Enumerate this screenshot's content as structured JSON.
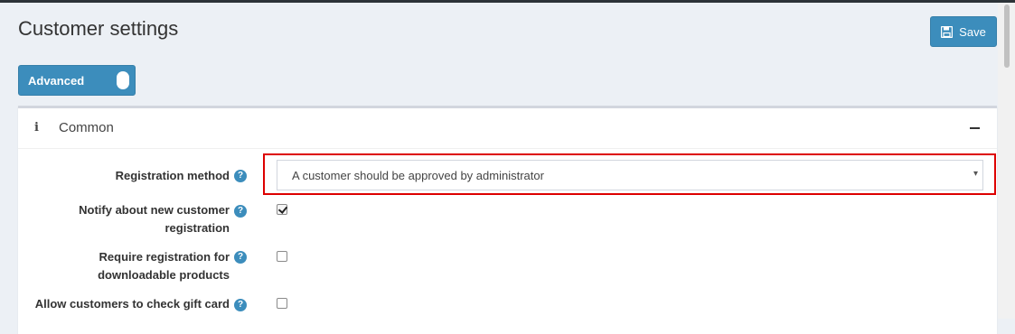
{
  "page": {
    "title": "Customer settings"
  },
  "toolbar": {
    "save_label": "Save",
    "save_icon": "floppy-disk-icon"
  },
  "advanced_toggle": {
    "label": "Advanced",
    "state": "on"
  },
  "panel": {
    "title": "Common",
    "info_icon": "i",
    "collapse_icon": "minus-icon"
  },
  "fields": {
    "registration_method": {
      "label": "Registration method",
      "value": "A customer should be approved by administrator",
      "arrow": "▾",
      "help": "?"
    },
    "notify_new_customer": {
      "label_line1": "Notify about new customer",
      "label_line2": "registration",
      "checked": true,
      "help": "?"
    },
    "require_registration_downloadable": {
      "label_line1": "Require registration for",
      "label_line2": "downloadable products",
      "checked": false,
      "help": "?"
    },
    "allow_check_gift_card": {
      "label_line1": "Allow customers to check gift card",
      "checked": false,
      "help": "?"
    }
  },
  "colors": {
    "accent": "#3c8dbc",
    "highlight": "#dd0000",
    "background": "#ecf0f5"
  }
}
